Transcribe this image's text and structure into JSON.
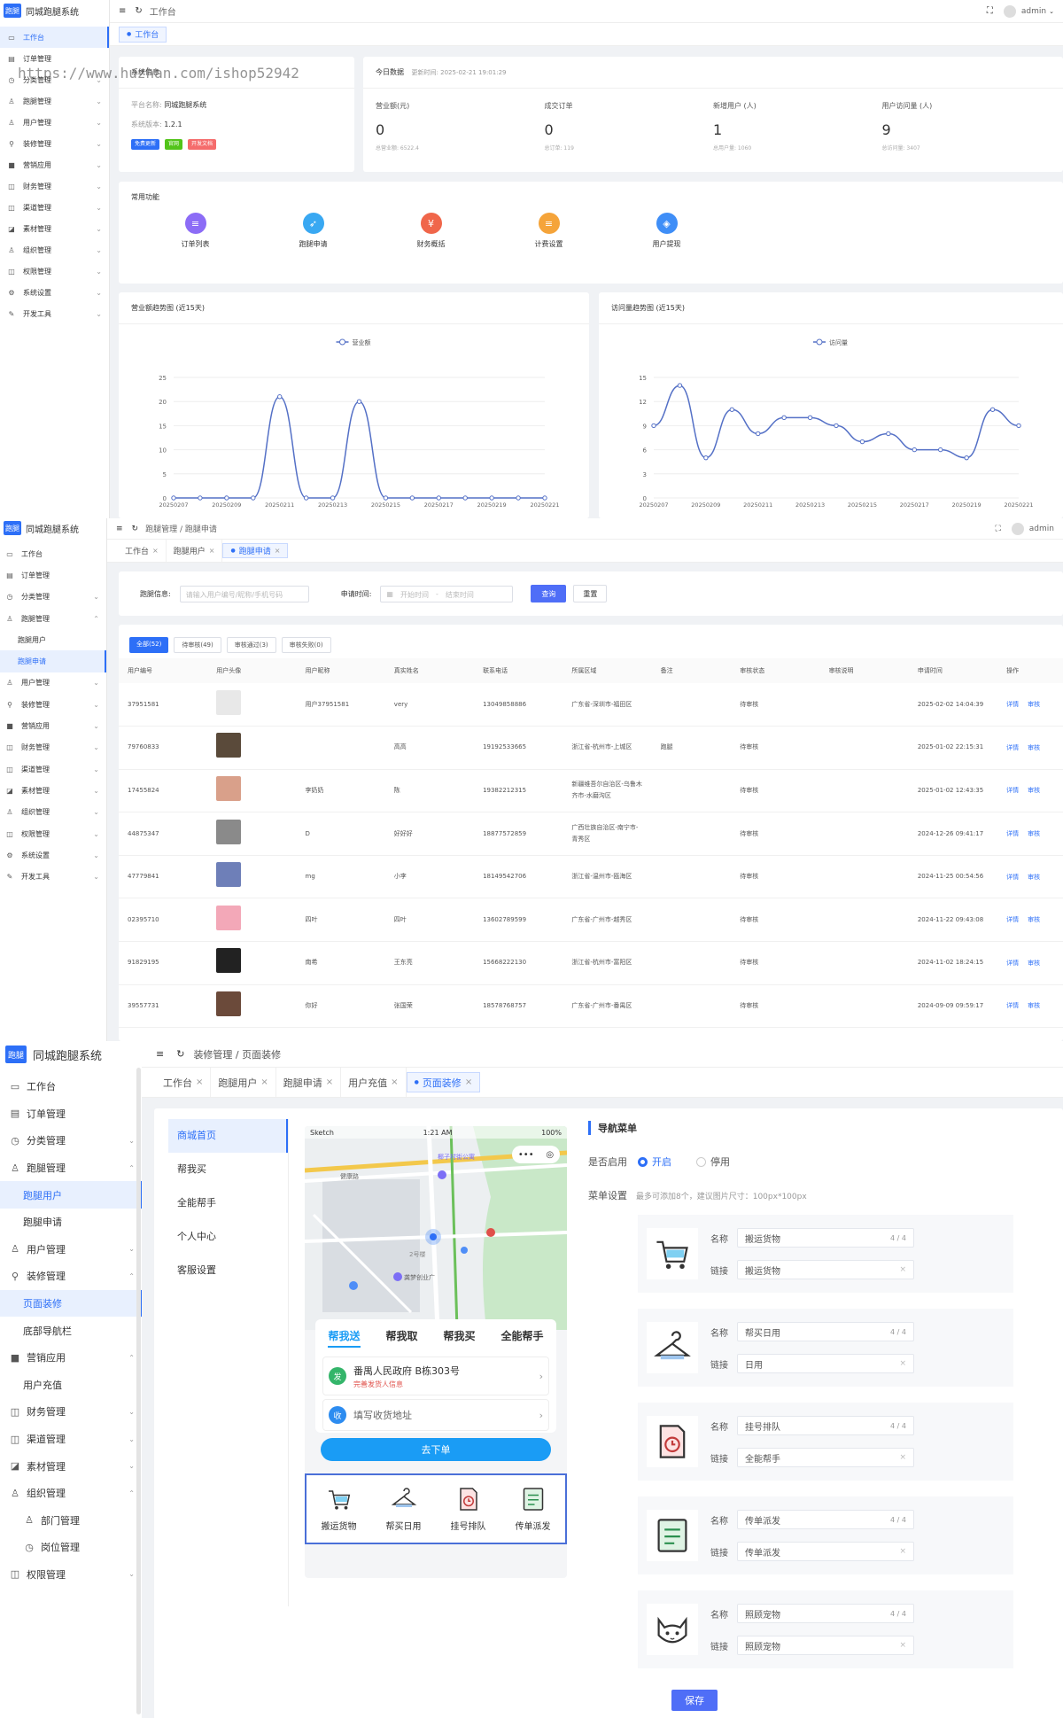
{
  "app": {
    "logo": "跑腿",
    "name": "同城跑腿系统",
    "user": "admin"
  },
  "watermark": "https://www.huzhan.com/ishop52942",
  "p1": {
    "menu": [
      {
        "icon": "▭",
        "label": "工作台",
        "active": true
      },
      {
        "icon": "▤",
        "label": "订单管理"
      },
      {
        "icon": "◷",
        "label": "分类管理",
        "chev": true
      },
      {
        "icon": "♙",
        "label": "跑腿管理",
        "chev": true
      },
      {
        "icon": "♙",
        "label": "用户管理",
        "chev": true
      },
      {
        "icon": "⚲",
        "label": "装修管理",
        "chev": true
      },
      {
        "icon": "■",
        "label": "营销应用",
        "chev": true
      },
      {
        "icon": "◫",
        "label": "财务管理",
        "chev": true
      },
      {
        "icon": "◫",
        "label": "渠道管理",
        "chev": true
      },
      {
        "icon": "◪",
        "label": "素材管理",
        "chev": true
      },
      {
        "icon": "♙",
        "label": "组织管理",
        "chev": true
      },
      {
        "icon": "◫",
        "label": "权限管理",
        "chev": true
      },
      {
        "icon": "⚙",
        "label": "系统设置",
        "chev": true
      },
      {
        "icon": "✎",
        "label": "开发工具",
        "chev": true
      }
    ],
    "tab": "工作台",
    "sysinfo": {
      "title": "系统信息",
      "name_label": "平台名称:",
      "name": "同城跑腿系统",
      "ver_label": "系统版本:",
      "ver": "1.2.1",
      "badges": [
        "免费更新",
        "官网",
        "开发文档"
      ]
    },
    "today": {
      "title": "今日数据",
      "updated": "更新时间: 2025-02-21 19:01:29",
      "stats": [
        {
          "label": "营业额(元)",
          "value": "0",
          "sub": "总营业额: 6522.4"
        },
        {
          "label": "成交订单",
          "value": "0",
          "sub": "总订单: 119"
        },
        {
          "label": "新增用户 (人)",
          "value": "1",
          "sub": "总用户量: 1060"
        },
        {
          "label": "用户访问量 (人)",
          "value": "9",
          "sub": "总访问量: 3407"
        }
      ]
    },
    "quick": {
      "title": "常用功能",
      "items": [
        {
          "icon": "≡",
          "label": "订单列表",
          "color": "#8c6cf6"
        },
        {
          "icon": "➶",
          "label": "跑腿申请",
          "color": "#39a8f2"
        },
        {
          "icon": "¥",
          "label": "财务概括",
          "color": "#f0664a"
        },
        {
          "icon": "≡",
          "label": "计费设置",
          "color": "#f5a43a"
        },
        {
          "icon": "◈",
          "label": "用户提现",
          "color": "#3f8ef7"
        }
      ]
    },
    "charts": [
      {
        "title": "营业额趋势图 (近15天)",
        "legend": "营业额"
      },
      {
        "title": "访问量趋势图 (近15天)",
        "legend": "访问量"
      }
    ]
  },
  "chart_data": [
    {
      "type": "line",
      "title": "营业额趋势图 (近15天)",
      "series": [
        {
          "name": "营业额",
          "values": [
            0,
            0,
            0,
            0,
            21,
            0,
            0,
            20,
            0,
            0,
            0,
            0,
            0,
            0,
            0
          ]
        }
      ],
      "x": [
        "20250207",
        "20250208",
        "20250209",
        "20250210",
        "20250211",
        "20250212",
        "20250213",
        "20250214",
        "20250215",
        "20250216",
        "20250217",
        "20250218",
        "20250219",
        "20250220",
        "20250221"
      ],
      "xticks": [
        "20250207",
        "20250209",
        "20250211",
        "20250213",
        "20250215",
        "20250217",
        "20250219",
        "20250221"
      ],
      "yticks": [
        0,
        5,
        10,
        15,
        20,
        25
      ],
      "ylim": [
        0,
        25
      ]
    },
    {
      "type": "line",
      "title": "访问量趋势图 (近15天)",
      "series": [
        {
          "name": "访问量",
          "values": [
            9,
            14,
            5,
            11,
            8,
            10,
            10,
            9,
            7,
            8,
            6,
            6,
            5,
            11,
            9
          ]
        }
      ],
      "x": [
        "20250207",
        "20250208",
        "20250209",
        "20250210",
        "20250211",
        "20250212",
        "20250213",
        "20250214",
        "20250215",
        "20250216",
        "20250217",
        "20250218",
        "20250219",
        "20250220",
        "20250221"
      ],
      "xticks": [
        "20250207",
        "20250209",
        "20250211",
        "20250213",
        "20250215",
        "20250217",
        "20250219",
        "20250221"
      ],
      "yticks": [
        0,
        3,
        6,
        9,
        12,
        15
      ],
      "ylim": [
        0,
        15
      ]
    }
  ],
  "p2": {
    "breadcrumb": [
      "跑腿管理",
      "跑腿申请"
    ],
    "menu": [
      {
        "icon": "▭",
        "label": "工作台"
      },
      {
        "icon": "▤",
        "label": "订单管理"
      },
      {
        "icon": "◷",
        "label": "分类管理",
        "chev": true
      },
      {
        "icon": "♙",
        "label": "跑腿管理",
        "chev": "up"
      },
      {
        "label": "跑腿用户",
        "sub": true
      },
      {
        "label": "跑腿申请",
        "sub": true,
        "active": true
      },
      {
        "icon": "♙",
        "label": "用户管理",
        "chev": true
      },
      {
        "icon": "⚲",
        "label": "装修管理",
        "chev": true
      },
      {
        "icon": "■",
        "label": "营销应用",
        "chev": true
      },
      {
        "icon": "◫",
        "label": "财务管理",
        "chev": true
      },
      {
        "icon": "◫",
        "label": "渠道管理",
        "chev": true
      },
      {
        "icon": "◪",
        "label": "素材管理",
        "chev": true
      },
      {
        "icon": "♙",
        "label": "组织管理",
        "chev": true
      },
      {
        "icon": "◫",
        "label": "权限管理",
        "chev": true
      },
      {
        "icon": "⚙",
        "label": "系统设置",
        "chev": true
      },
      {
        "icon": "✎",
        "label": "开发工具",
        "chev": true
      }
    ],
    "tabs": [
      "工作台",
      "跑腿用户",
      "跑腿申请"
    ],
    "filter": {
      "info_label": "跑腿信息:",
      "info_ph": "请输入用户编号/昵称/手机号码",
      "time_label": "申请时间:",
      "start_ph": "开始时间",
      "sep": "-",
      "end_ph": "结束时间",
      "search": "查询",
      "reset": "重置"
    },
    "status_tabs": [
      "全部(52)",
      "待审核(49)",
      "审核通过(3)",
      "审核失败(0)"
    ],
    "columns": [
      "用户编号",
      "用户头像",
      "用户昵称",
      "真实姓名",
      "联系电话",
      "所属区域",
      "备注",
      "审核状态",
      "审核说明",
      "申请时间",
      "操作"
    ],
    "rows": [
      {
        "id": "37951581",
        "avatar": "#e8e8e8",
        "nick": "用户37951581",
        "name": "very",
        "phone": "13049858886",
        "area": "广东省-深圳市-福田区",
        "note": "",
        "status": "待审核",
        "desc": "",
        "time": "2025-02-02 14:04:39"
      },
      {
        "id": "79760833",
        "avatar": "#5a4a3a",
        "nick": "",
        "name": "高高",
        "phone": "19192533665",
        "area": "浙江省-杭州市-上城区",
        "note": "跑腿",
        "status": "待审核",
        "desc": "",
        "time": "2025-01-02 22:15:31"
      },
      {
        "id": "17455824",
        "avatar": "#d9a08a",
        "nick": "李奶奶",
        "name": "陈",
        "phone": "19382212315",
        "area": "新疆维吾尔自治区-乌鲁木齐市-水磨沟区",
        "note": "",
        "status": "待审核",
        "desc": "",
        "time": "2025-01-02 12:43:35"
      },
      {
        "id": "44875347",
        "avatar": "#8a8a8a",
        "nick": "D",
        "name": "好好好",
        "phone": "18877572859",
        "area": "广西壮族自治区-南宁市-青秀区",
        "note": "",
        "status": "待审核",
        "desc": "",
        "time": "2024-12-26 09:41:17"
      },
      {
        "id": "47779841",
        "avatar": "#6e7fb8",
        "nick": "mg",
        "name": "小李",
        "phone": "18149542706",
        "area": "浙江省-温州市-瓯海区",
        "note": "",
        "status": "待审核",
        "desc": "",
        "time": "2024-11-25 00:54:56"
      },
      {
        "id": "02395710",
        "avatar": "#f3a8b8",
        "nick": "四叶",
        "name": "四叶",
        "phone": "13602789599",
        "area": "广东省-广州市-越秀区",
        "note": "",
        "status": "待审核",
        "desc": "",
        "time": "2024-11-22 09:43:08"
      },
      {
        "id": "91829195",
        "avatar": "#222",
        "nick": "南希",
        "name": "王东亮",
        "phone": "15668222130",
        "area": "浙江省-杭州市-富阳区",
        "note": "",
        "status": "待审核",
        "desc": "",
        "time": "2024-11-02 18:24:15"
      },
      {
        "id": "39557731",
        "avatar": "#6b4a3a",
        "nick": "你好",
        "name": "张国荣",
        "phone": "18578768757",
        "area": "广东省-广州市-番禺区",
        "note": "",
        "status": "待审核",
        "desc": "",
        "time": "2024-09-09 09:59:17"
      }
    ],
    "ops": [
      "详情",
      "审核"
    ]
  },
  "p3": {
    "breadcrumb": [
      "装修管理",
      "页面装修"
    ],
    "menu": [
      {
        "icon": "▭",
        "label": "工作台"
      },
      {
        "icon": "▤",
        "label": "订单管理"
      },
      {
        "icon": "◷",
        "label": "分类管理",
        "chev": true
      },
      {
        "icon": "♙",
        "label": "跑腿管理",
        "chev": "up"
      },
      {
        "label": "跑腿用户",
        "sub": true,
        "active": true
      },
      {
        "label": "跑腿申请",
        "sub": true
      },
      {
        "icon": "♙",
        "label": "用户管理",
        "chev": true
      },
      {
        "icon": "⚲",
        "label": "装修管理",
        "chev": "up"
      },
      {
        "label": "页面装修",
        "sub": true,
        "active": true
      },
      {
        "label": "底部导航栏",
        "sub": true
      },
      {
        "icon": "■",
        "label": "营销应用",
        "chev": "up"
      },
      {
        "label": "用户充值",
        "sub": true
      },
      {
        "icon": "◫",
        "label": "财务管理",
        "chev": true
      },
      {
        "icon": "◫",
        "label": "渠道管理",
        "chev": true
      },
      {
        "icon": "◪",
        "label": "素材管理",
        "chev": true
      },
      {
        "icon": "♙",
        "label": "组织管理",
        "chev": "up"
      },
      {
        "label": "部门管理",
        "sub": true,
        "icon": "♙"
      },
      {
        "label": "岗位管理",
        "sub": true,
        "icon": "◷"
      },
      {
        "icon": "◫",
        "label": "权限管理",
        "chev": true
      }
    ],
    "tabs": [
      "工作台",
      "跑腿用户",
      "跑腿申请",
      "用户充值",
      "页面装修"
    ],
    "pages": [
      "商城首页",
      "帮我买",
      "全能帮手",
      "个人中心",
      "客服设置"
    ],
    "phone": {
      "carrier": "Sketch",
      "time": "1:21 AM",
      "battery": "100%",
      "map_labels": [
        "椰子村街公寓",
        "健康路",
        "2号楼",
        "龚梦创业广"
      ],
      "tabs": [
        "帮我送",
        "帮我取",
        "帮我买",
        "全能帮手"
      ],
      "from_badge": "发",
      "from": "番禺人民政府 B栋303号",
      "from_sub": "完善发货人信息",
      "to_badge": "收",
      "to": "填写收货地址",
      "order": "去下单",
      "nav": [
        {
          "label": "搬运货物",
          "icon": "cart"
        },
        {
          "label": "帮买日用",
          "icon": "hanger"
        },
        {
          "label": "挂号排队",
          "icon": "doc"
        },
        {
          "label": "传单派发",
          "icon": "list"
        }
      ]
    },
    "nav_title": "导航菜单",
    "enable_label": "是否启用",
    "enable_on": "开启",
    "enable_off": "停用",
    "menu_setting_label": "菜单设置",
    "menu_setting_hint": "最多可添加8个，建议图片尺寸：100px*100px",
    "name_label": "名称",
    "link_label": "链接",
    "items": [
      {
        "icon": "cart",
        "name": "搬运货物",
        "count": "4 / 4",
        "link": "搬运货物"
      },
      {
        "icon": "hanger",
        "name": "帮买日用",
        "count": "4 / 4",
        "link": "日用"
      },
      {
        "icon": "doc",
        "name": "挂号排队",
        "count": "4 / 4",
        "link": "全能帮手"
      },
      {
        "icon": "list",
        "name": "传单派发",
        "count": "4 / 4",
        "link": "传单派发"
      },
      {
        "icon": "cat",
        "name": "照顾宠物",
        "count": "4 / 4",
        "link": "照顾宠物"
      }
    ],
    "save": "保存"
  }
}
